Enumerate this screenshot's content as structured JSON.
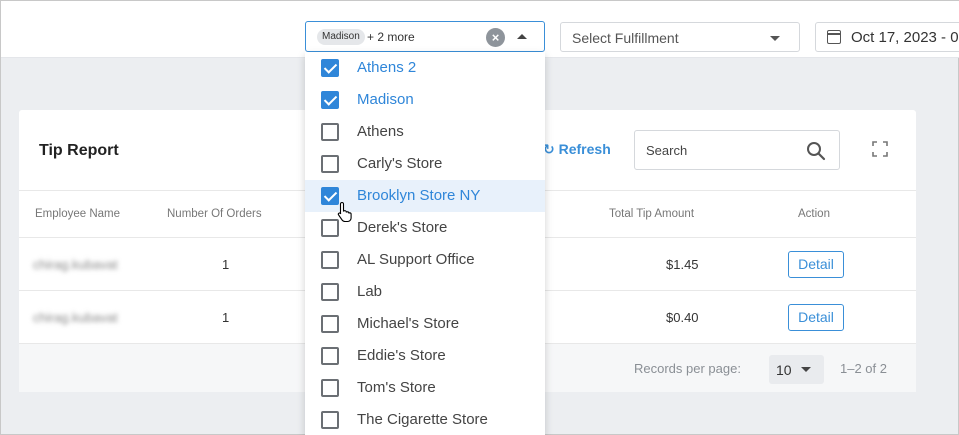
{
  "header": {
    "store_select": {
      "chip": "Madison",
      "more": "+ 2 more"
    },
    "fulfillment_placeholder": "Select Fulfillment",
    "date_value": "Oct 17, 2023 - 0"
  },
  "card": {
    "title": "Tip Report",
    "refresh_label": "Refresh",
    "search_placeholder": "Search",
    "columns": [
      "Employee Name",
      "Number Of Orders",
      "Total Tip Amount",
      "Action"
    ],
    "rows": [
      {
        "employee": "chirag.kubavat",
        "orders": "1",
        "tip": "$1.45",
        "action": "Detail"
      },
      {
        "employee": "chirag.kubavat",
        "orders": "1",
        "tip": "$0.40",
        "action": "Detail"
      }
    ],
    "footer": {
      "records_label": "Records per page:",
      "per_page": "10",
      "range": "1–2 of 2"
    }
  },
  "dropdown": {
    "options": [
      {
        "label": "Athens 2",
        "checked": true
      },
      {
        "label": "Madison",
        "checked": true
      },
      {
        "label": "Athens",
        "checked": false
      },
      {
        "label": "Carly's Store",
        "checked": false
      },
      {
        "label": "Brooklyn Store NY",
        "checked": true
      },
      {
        "label": "Derek's Store",
        "checked": false
      },
      {
        "label": "AL Support Office",
        "checked": false
      },
      {
        "label": "Lab",
        "checked": false
      },
      {
        "label": "Michael's Store",
        "checked": false
      },
      {
        "label": "Eddie's Store",
        "checked": false
      },
      {
        "label": "Tom's Store",
        "checked": false
      },
      {
        "label": "The Cigarette Store",
        "checked": false
      }
    ]
  },
  "colors": {
    "accent": "#2f86d9",
    "hover": "#e8f1fb",
    "background": "#eceef1"
  }
}
